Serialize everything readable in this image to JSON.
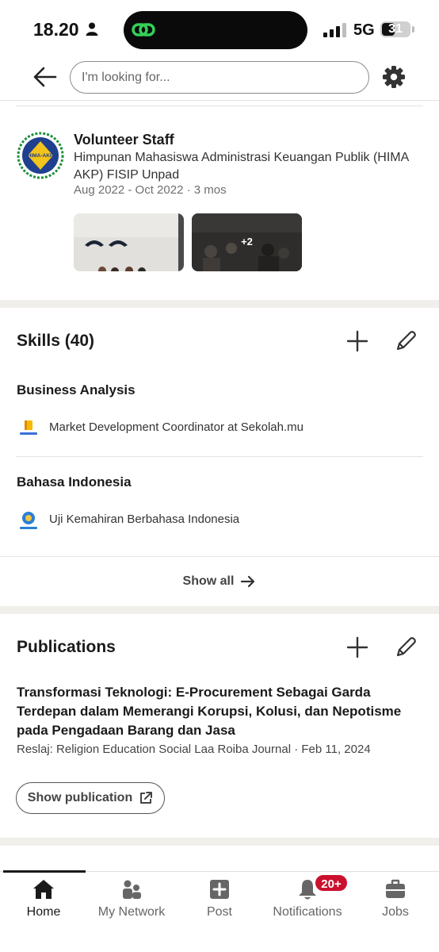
{
  "status_bar": {
    "time": "18.20",
    "network": "5G",
    "battery": "31",
    "battery_level": 0.31
  },
  "header": {
    "search_placeholder": "I'm looking for...",
    "back_icon": "arrow-left-icon",
    "settings_icon": "gear-icon"
  },
  "volunteer": {
    "title": "Volunteer Staff",
    "organization": "Himpunan Mahasiswa Administrasi Keuangan Publik (HIMA AKP) FISIP Unpad",
    "dates": "Aug 2022 - Oct 2022 · 3 mos",
    "logo_text": "HIMA-AKP",
    "more_media": "+2"
  },
  "skills": {
    "title": "Skills (40)",
    "items": [
      {
        "name": "Business Analysis",
        "source": "Market Development Coordinator at Sekolah.mu",
        "logo": "sekolahmu-logo"
      },
      {
        "name": "Bahasa Indonesia",
        "source": "Uji Kemahiran Berbahasa Indonesia",
        "logo": "kemendikbud-logo"
      }
    ],
    "show_all": "Show all"
  },
  "publications": {
    "title": "Publications",
    "item_title": "Transformasi Teknologi: E-Procurement Sebagai Garda Terdepan dalam Memerangi Korupsi, Kolusi, dan Nepotisme pada Pengadaan Barang dan Jasa",
    "item_meta": "Reslaj: Religion Education Social Laa Roiba Journal · Feb 11, 2024",
    "show_button": "Show publication"
  },
  "nav": {
    "items": [
      {
        "label": "Home",
        "icon": "home-icon",
        "active": true
      },
      {
        "label": "My Network",
        "icon": "network-icon"
      },
      {
        "label": "Post",
        "icon": "post-icon"
      },
      {
        "label": "Notifications",
        "icon": "bell-icon"
      },
      {
        "label": "Jobs",
        "icon": "briefcase-icon"
      }
    ],
    "notification_badge": "20+"
  },
  "colors": {
    "accent_badge": "#cb112d",
    "section_gap": "#f1efeb"
  }
}
